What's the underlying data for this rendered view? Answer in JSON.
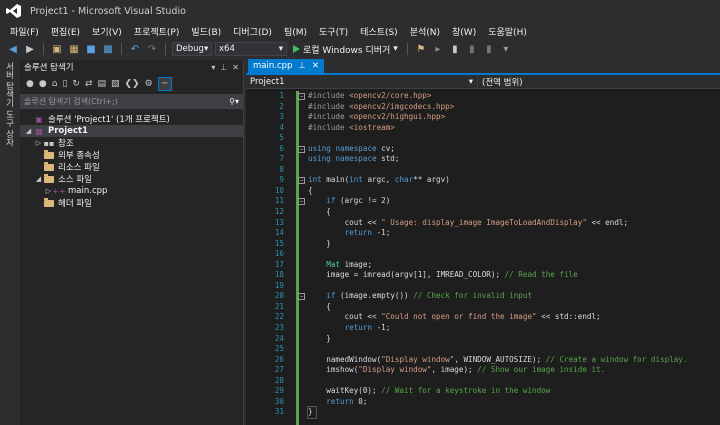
{
  "window": {
    "title": "Project1 - Microsoft Visual Studio"
  },
  "menu": [
    "파일(F)",
    "편집(E)",
    "보기(V)",
    "프로젝트(P)",
    "빌드(B)",
    "디버그(D)",
    "팀(M)",
    "도구(T)",
    "테스트(S)",
    "분석(N)",
    "창(W)",
    "도움말(H)"
  ],
  "toolbar": {
    "config": "Debug",
    "platform": "x64",
    "run_label": "로컬 Windows 디버거"
  },
  "vertical_tabs": {
    "server_explorer": "서버 탐색기",
    "toolbox": "도구 상자"
  },
  "solution_explorer": {
    "title": "솔루션 탐색기",
    "search_placeholder": "솔루션 탐색기 검색(Ctrl+;)",
    "items": [
      {
        "label": "솔루션 'Project1' (1개 프로젝트)",
        "level": 0
      },
      {
        "label": "Project1",
        "level": 1
      },
      {
        "label": "참조",
        "level": 2
      },
      {
        "label": "외부 종속성",
        "level": 2
      },
      {
        "label": "리소스 파일",
        "level": 2
      },
      {
        "label": "소스 파일",
        "level": 2
      },
      {
        "label": "main.cpp",
        "level": 3
      },
      {
        "label": "헤더 파일",
        "level": 2
      }
    ]
  },
  "editor": {
    "tab_label": "main.cpp",
    "nav_project": "Project1",
    "nav_scope": "(전역 범위)",
    "line_numbers": [
      "1",
      "2",
      "3",
      "4",
      "5",
      "6",
      "7",
      "8",
      "9",
      "10",
      "11",
      "12",
      "13",
      "14",
      "15",
      "16",
      "17",
      "18",
      "19",
      "20",
      "21",
      "22",
      "23",
      "24",
      "25",
      "26",
      "27",
      "28",
      "29",
      "30",
      "31"
    ]
  },
  "colors": {
    "accent": "#007acc",
    "keyword": "#569cd6",
    "string": "#d69d85",
    "comment": "#57a64a",
    "line_number": "#2b91af"
  }
}
